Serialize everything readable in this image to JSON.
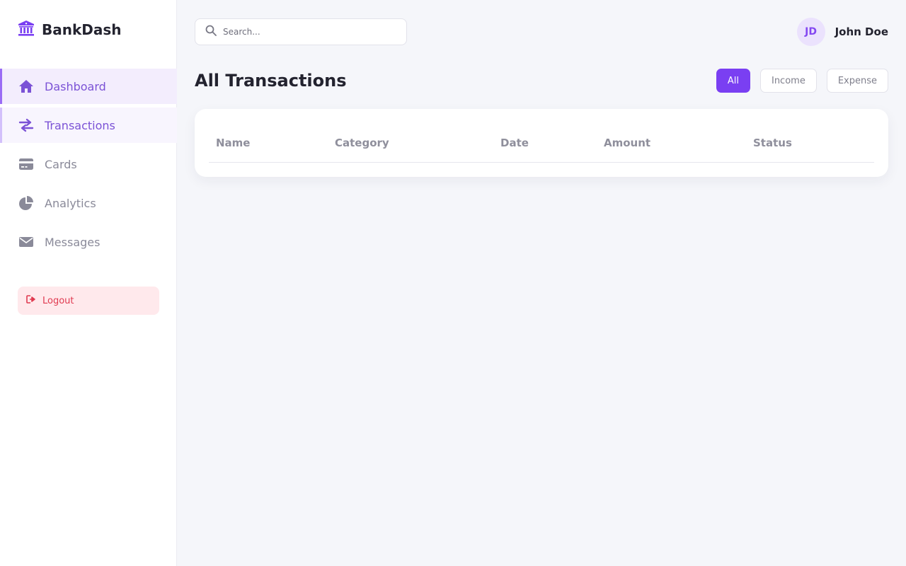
{
  "brand": {
    "name": "BankDash",
    "icon": "bank-icon",
    "color": "#7a3ff2"
  },
  "sidebar": {
    "items": [
      {
        "label": "Dashboard",
        "icon": "home-icon",
        "state": "active"
      },
      {
        "label": "Transactions",
        "icon": "swap-arrows-icon",
        "state": "hover"
      },
      {
        "label": "Cards",
        "icon": "credit-card-icon",
        "state": ""
      },
      {
        "label": "Analytics",
        "icon": "pie-chart-icon",
        "state": ""
      },
      {
        "label": "Messages",
        "icon": "envelope-icon",
        "state": ""
      }
    ],
    "logout": {
      "label": "Logout",
      "icon": "sign-out-icon",
      "color": "#e03a50"
    }
  },
  "search": {
    "placeholder": "Search...",
    "value": ""
  },
  "user": {
    "initials": "JD",
    "name": "John Doe"
  },
  "page": {
    "title": "All Transactions"
  },
  "filters": [
    {
      "label": "All",
      "active": true
    },
    {
      "label": "Income",
      "active": false
    },
    {
      "label": "Expense",
      "active": false
    }
  ],
  "table": {
    "columns": [
      "Name",
      "Category",
      "Date",
      "Amount",
      "Status"
    ],
    "rows": []
  },
  "colors": {
    "accent": "#7a3ff2",
    "background": "#f5f6fa",
    "danger": "#e03a50"
  }
}
